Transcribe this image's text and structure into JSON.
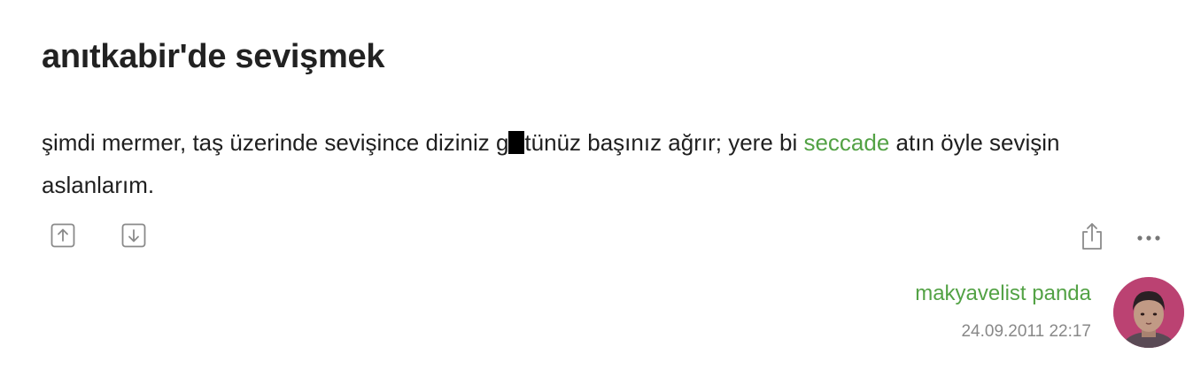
{
  "topic": {
    "title": "anıtkabir'de sevişmek"
  },
  "entry": {
    "text_before": "şimdi mermer, taş üzerinde sevişince diziniz g",
    "text_after_censor": "tünüz başınız ağrır; yere bi ",
    "link_text": "seccade",
    "text_after_link": " atın öyle sevişin aslanlarım."
  },
  "actions": {
    "upvote_icon": "arrow-up-icon",
    "downvote_icon": "arrow-down-icon",
    "share_icon": "share-icon",
    "more_icon": "more-icon"
  },
  "author": {
    "name": "makyavelist panda",
    "date": "24.09.2011 22:17"
  },
  "colors": {
    "link": "#53a245",
    "title": "#222222",
    "meta": "#888888",
    "icon": "#8a8a8a"
  }
}
